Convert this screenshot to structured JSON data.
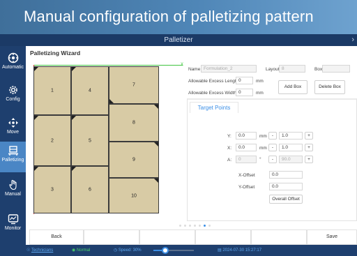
{
  "banner": {
    "title": "Manual configuration of palletizing pattern"
  },
  "window": {
    "title": "Palletizer",
    "close_icon": "close-icon"
  },
  "sidebar": {
    "items": [
      {
        "label": "Automatic",
        "icon": "automatic-icon"
      },
      {
        "label": "Config",
        "icon": "config-icon"
      },
      {
        "label": "Move",
        "icon": "move-icon"
      },
      {
        "label": "Palletizing",
        "icon": "palletizing-icon",
        "active": true
      },
      {
        "label": "Manual",
        "icon": "hand-icon"
      },
      {
        "label": "Monitor",
        "icon": "monitor-icon"
      }
    ]
  },
  "wizard": {
    "title": "Palletizing Wizard"
  },
  "pallet": {
    "axis_x_label": "X",
    "boxes": [
      "1",
      "2",
      "3",
      "4",
      "5",
      "6",
      "7",
      "8",
      "9",
      "10"
    ]
  },
  "form": {
    "name_label": "Name",
    "name_value": "Formulation_2",
    "layout_label": "Layout",
    "layout_value": "8",
    "box_label": "Box",
    "box_value": "",
    "excess_length_label": "Allowable Excess Length",
    "excess_length_value": "0",
    "excess_length_unit": "mm",
    "excess_width_label": "Allowable Excess Width",
    "excess_width_value": "0",
    "excess_width_unit": "mm",
    "add_box_label": "Add Box",
    "delete_box_label": "Delete Box"
  },
  "target_points": {
    "tab_label": "Target Points",
    "y_label": "Y:",
    "y_value": "0.0",
    "y_unit": "mm",
    "y_step": "1.0",
    "x_label": "X:",
    "x_value": "0.0",
    "x_unit": "mm",
    "x_step": "1.0",
    "a_label": "A:",
    "a_value": "0",
    "a_unit": "°",
    "a_step": "90.0",
    "minus": "-",
    "plus": "+",
    "x_offset_label": "X-Offset",
    "x_offset_value": "0.0",
    "y_offset_label": "Y-Offset",
    "y_offset_value": "0.0",
    "overall_offset_label": "Overall Offset"
  },
  "footer": {
    "back_label": "Back",
    "save_label": "Save"
  },
  "status": {
    "user": "Technicians",
    "user_icon": "user-icon",
    "state": "Normal",
    "state_icon": "status-ok-icon",
    "speed": "Speed: 30%",
    "speed_icon": "speed-icon",
    "speed_percent": 30,
    "datetime": "2024-07-30 15:27:17",
    "calendar_icon": "calendar-icon"
  },
  "colors": {
    "banner": "#4f86b7",
    "sidebar": "#1e3f6e",
    "active_nav": "#4a86c5",
    "box_fill": "#d8cba5",
    "accent": "#3a8ee6",
    "axis_x": "#3ec43e",
    "axis_y": "#e03030"
  }
}
